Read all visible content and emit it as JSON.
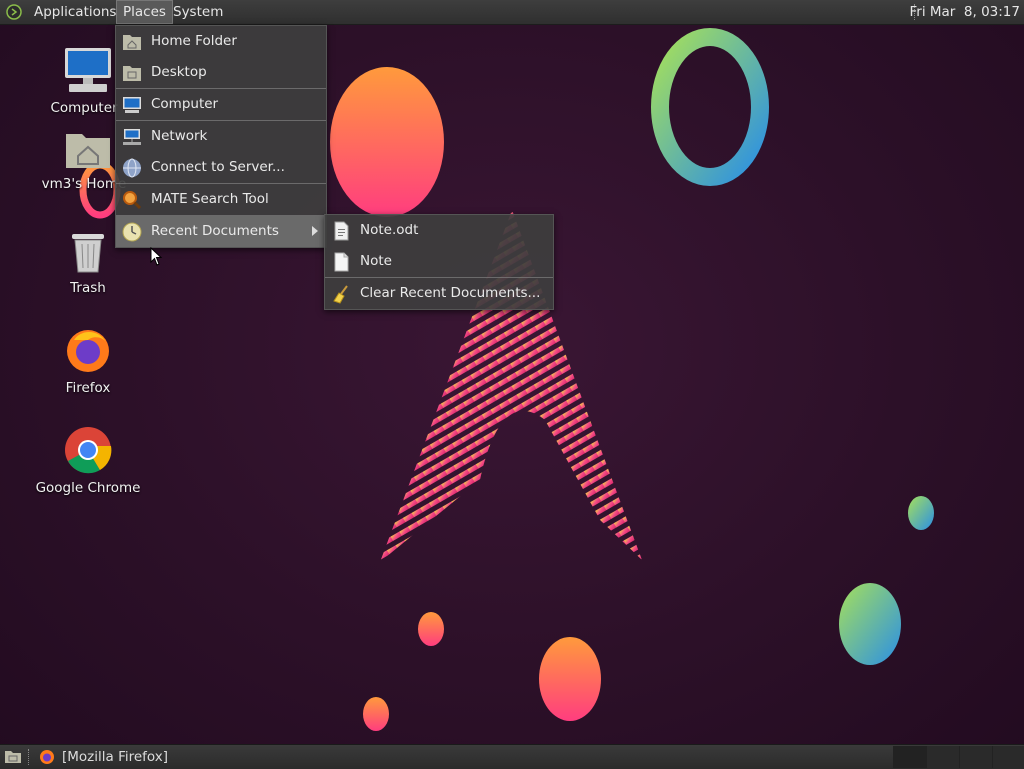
{
  "top_panel": {
    "menus": [
      "Applications",
      "Places",
      "System"
    ],
    "clock": "Fri Mar  8, 03:17"
  },
  "desktop_icons": [
    {
      "label": "Computer",
      "icon": "computer-icon"
    },
    {
      "label": "vm3's Home",
      "icon": "home-folder-icon"
    },
    {
      "label": "Trash",
      "icon": "trash-icon"
    },
    {
      "label": "Firefox",
      "icon": "firefox-icon"
    },
    {
      "label": "Google Chrome",
      "icon": "chrome-icon"
    }
  ],
  "places_menu": {
    "items": [
      {
        "label": "Home Folder",
        "icon": "home-folder-icon"
      },
      {
        "label": "Desktop",
        "icon": "desktop-folder-icon"
      },
      {
        "label": "Computer",
        "icon": "computer-icon"
      },
      {
        "label": "Network",
        "icon": "network-icon"
      },
      {
        "label": "Connect to Server...",
        "icon": "globe-icon"
      },
      {
        "label": "MATE Search Tool",
        "icon": "search-icon"
      },
      {
        "label": "Recent Documents",
        "icon": "clock-icon"
      }
    ]
  },
  "recent_menu": {
    "items": [
      {
        "label": "Note.odt",
        "icon": "document-icon"
      },
      {
        "label": "Note",
        "icon": "text-file-icon"
      },
      {
        "label": "Clear Recent Documents...",
        "icon": "broom-icon"
      }
    ]
  },
  "bottom_panel": {
    "taskbar_item": "[Mozilla Firefox]"
  },
  "colors": {
    "desktop_bg": "#2c1028",
    "panel_bg": "#333333",
    "menu_highlight": "#6a6a6a"
  }
}
